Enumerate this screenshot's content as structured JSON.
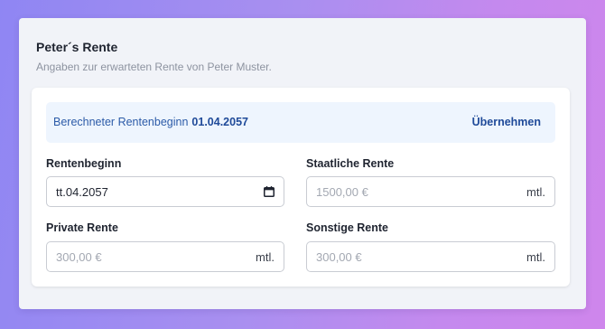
{
  "card": {
    "title": "Peter´s Rente",
    "subtitle": "Angaben zur erwarteten Rente von Peter Muster."
  },
  "banner": {
    "text": "Berechneter Rentenbeginn",
    "date": "01.04.2057",
    "action_label": "Übernehmen"
  },
  "fields": {
    "rentenbeginn": {
      "label": "Rentenbeginn",
      "value": "tt.04.2057",
      "icon": "calendar-icon"
    },
    "staatliche": {
      "label": "Staatliche Rente",
      "placeholder": "1500,00 €",
      "suffix": "mtl."
    },
    "private": {
      "label": "Private Rente",
      "placeholder": "300,00 €",
      "suffix": "mtl."
    },
    "sonstige": {
      "label": "Sonstige Rente",
      "placeholder": "300,00 €",
      "suffix": "mtl."
    }
  },
  "colors": {
    "accent": "#1f4a99",
    "banner_bg": "#eef5fe",
    "card_bg": "#f1f3f8"
  }
}
